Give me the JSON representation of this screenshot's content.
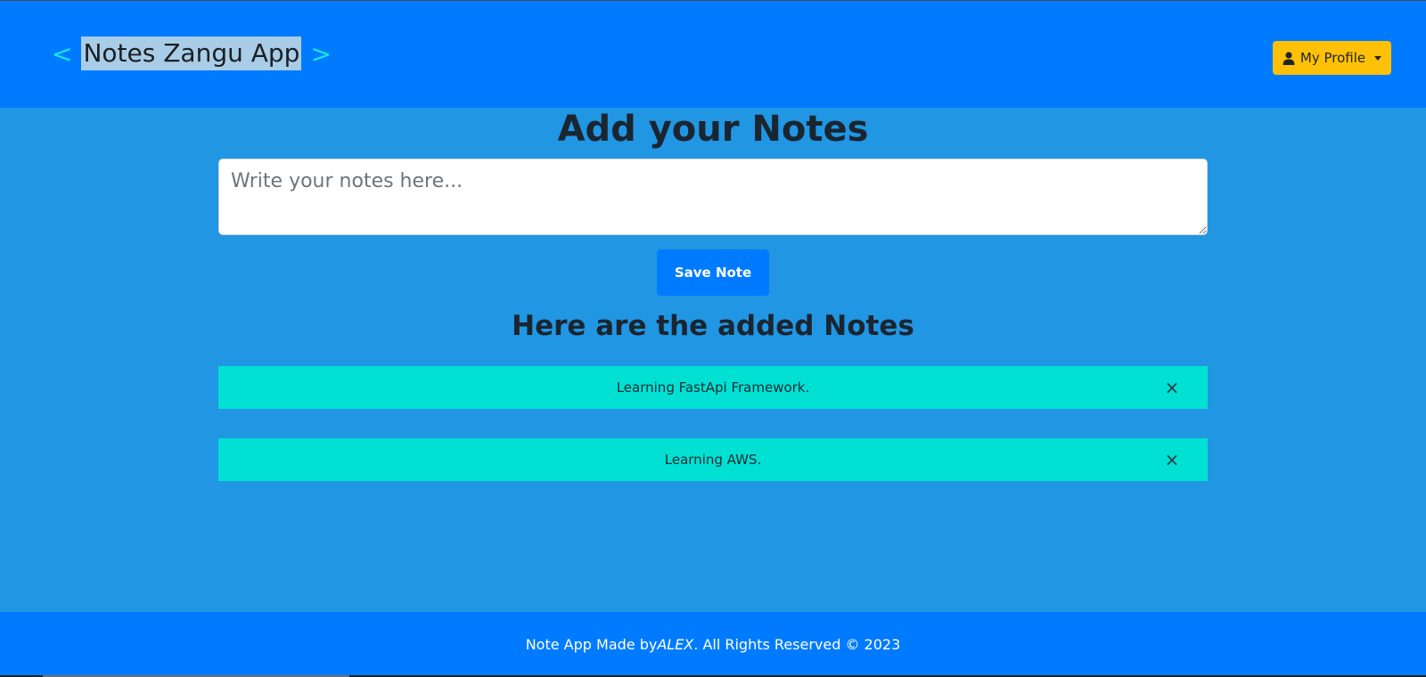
{
  "header": {
    "open_bracket": "<",
    "title": "Notes Zangu App",
    "close_bracket": ">",
    "profile_label": "My Profile"
  },
  "main": {
    "add_heading": "Add your Notes",
    "input_placeholder": "Write your notes here...",
    "input_value": "",
    "save_label": "Save Note",
    "list_heading": "Here are the added Notes",
    "notes": [
      {
        "text": "Learning FastApi Framework.",
        "close": "×"
      },
      {
        "text": "Learning AWS.",
        "close": "×"
      }
    ]
  },
  "footer": {
    "prefix": "Note App Made by ",
    "author": "ALEX",
    "suffix": ". All Rights Reserved © 2023"
  },
  "colors": {
    "header_bg": "#007bff",
    "page_bg": "#2196e3",
    "bracket": "#17e3e3",
    "profile_btn": "#ffc107",
    "note_bg": "#00e1d4",
    "save_btn": "#007bff"
  },
  "icons": {
    "profile": "user-icon",
    "dropdown": "caret-down-icon",
    "close": "close-icon"
  }
}
